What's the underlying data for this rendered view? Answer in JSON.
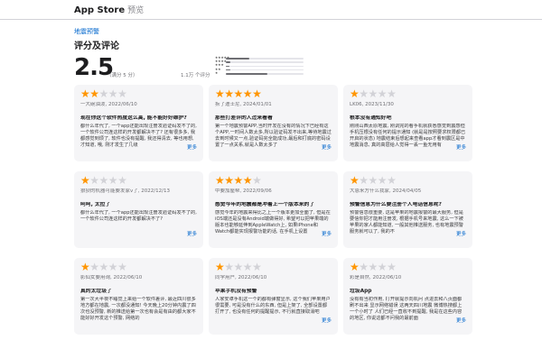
{
  "header": {
    "title": "App Store",
    "subtitle": "预览"
  },
  "app_link": "地震预警",
  "section_title": "评分及评论",
  "summary": {
    "rating": "2.5",
    "out_of": "（满分 5 分）",
    "count": "1.1万 个评分"
  },
  "histogram": [
    {
      "stars": "★★★★★",
      "fraction": 0.3
    },
    {
      "stars": "★★★★",
      "fraction": 0.06
    },
    {
      "stars": "★★★",
      "fraction": 0.05
    },
    {
      "stars": "★★",
      "fraction": 0.06
    },
    {
      "stars": "★",
      "fraction": 0.53
    }
  ],
  "more_label": "更多",
  "reviews": [
    {
      "rating": 2,
      "meta": "一大碗油泼, 2022/06/10",
      "title": "现在你这个软件热度这么高, 能不能好好维护?",
      "body": "都什么年代了, 一个app还能出现注册发验证码发不了的, 一个软件公司连这样的开发都解决不了? 还有很多多, 我都感觉到烦了, 软件也没有提醒, 我还得清去, 等也用想, 才知道, 哦, 刚才发生了几级",
      "has_more": true
    },
    {
      "rating": 5,
      "meta": "拆了迪士尼, 2024/01/01",
      "title": "那些打差评的人过来看看",
      "body": "第一个地震预警APP,当时开发在没有的情况下已经有这个APP,一时间人数太多,所以验证码发不出来,等待地震过去到时候又一点,验证码完全能成功,最后和打底的密码设置了一点关系,就是人数太多了",
      "has_more": true
    },
    {
      "rating": 1,
      "meta": "LK06, 2023/11/30",
      "title": "根本没有通知好吧",
      "body": "刚刚山西太原地震, 刚调完的看手机就获悉感觉到震感但手机压根没有任何的提示通知 (就是是按照要求权限都已开启的状态) 地震结束后想起来查看app才看到震区是中地震消息, 真的高层给人觉得一丢一鱼无用有",
      "has_more": true
    },
    {
      "rating": 1,
      "meta": "狼狈的机器可能要发家v了, 2022/12/13",
      "title": "呵呵, 太拉了",
      "body": "都什么年代了, 一个app还能出现注册发验证码发不了的, 一个软件公司连这样的开发都解决不了?",
      "has_more": true
    },
    {
      "rating": 4,
      "meta": "中要加屋帮, 2022/09/06",
      "title": "感觉今年的地震都是冲着上一个版本来的了",
      "body": "感觉今年的地震来得比之上一个版本更加全面了, 但是在iOS端还是没有Android端做得好, 希望可以把苹果端的版本也能够延伸到AppleWatch上, 如果iPhone和Watch都能实现报警功能的话, 在手机上设置",
      "has_more": true
    },
    {
      "rating": 1,
      "meta": "大恩来方什么我家, 2024/04/05",
      "title": "预警信息为什么要注册个人电话信息呢?",
      "body": "预警信息很重要, 这是苹果的地震报警的最大服务, 但是要信你把才能用注册发, 根据手机号来地震, 这么一下被苹果的家人都能知道, 一般其他推送服务, 也有地震预警服务就可以了, 我的不",
      "has_more": true
    },
    {
      "rating": 1,
      "meta": "影仙女要用询, 2022/06/10",
      "title": "真的太垃圾了",
      "body": "第一次大半夜不睡觉上来给一个软件差评, 最近四川很多地方都在地震, 一次都没通知! 今天晚上20分钟内震了四次也没预警, 新的推送给第一次也有会是有由的都大家不能好好开发这个预警, 网络的",
      "has_more": false
    },
    {
      "rating": 1,
      "meta": "同学用户, 2022/06/10",
      "title": "苹果手机没有预警",
      "body": "人家安卓手机这一个的都有弹窗显示, 这个我们苹果用户很需要, 可是没有什么的东西, 但是上架了, 全部设置都打开了, 也没有任何的提醒提示, 不行就直接取消吧",
      "has_more": true
    },
    {
      "rating": 1,
      "meta": "彩是自然, 2022/06/10",
      "title": "垃圾App",
      "body": "没有有当初作用, 打开就提示向机问 点进去和八页面都刷不出来 显示网络错误 这两天四川地震 微博热搜都上一个小时了 人们已经一直收不到提醒, 我是在这些内容的地区, 你说这都不问我的最前面",
      "has_more": true
    }
  ],
  "colors": {
    "star": "#ff9500",
    "star_off": "#d2d2d7",
    "link": "#0066cc",
    "card_bg": "#f5f5f7"
  }
}
